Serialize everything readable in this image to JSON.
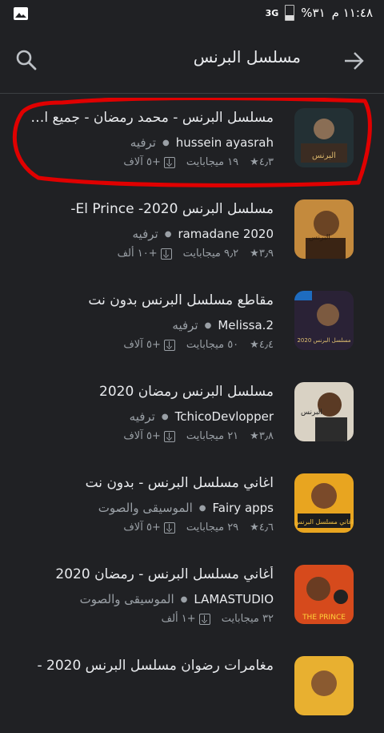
{
  "status_bar": {
    "time": "١١:٤٨ م",
    "battery": "%٣١",
    "signal": "3G"
  },
  "search": {
    "query": "مسلسل البرنس"
  },
  "apps": [
    {
      "title": "مسلسل البرنس - محمد رمضان - جميع ال...",
      "developer": "hussein ayasrah",
      "category": "ترفيه",
      "rating": "٤٫٣",
      "size": "١٩ ميجابايت",
      "installs": "+٥ آلاف"
    },
    {
      "title": "مسلسل البرنس 2020- El Prince-",
      "developer": "ramadane 2020",
      "category": "ترفيه",
      "rating": "٣٫٩",
      "size": "٩٫٢ ميجابايت",
      "installs": "+١٠ ألف"
    },
    {
      "title": "مقاطع مسلسل البرنس بدون نت",
      "developer": "Melissa.2",
      "category": "ترفيه",
      "rating": "٤٫٤",
      "size": "٥٠ ميجابايت",
      "installs": "+٥ آلاف"
    },
    {
      "title": "مسلسل البرنس رمضان 2020",
      "developer": "TchicoDevlopper",
      "category": "ترفيه",
      "rating": "٣٫٨",
      "size": "٢١ ميجابايت",
      "installs": "+٥ آلاف"
    },
    {
      "title": "اغاني مسلسل البرنس - بدون نت",
      "developer": "Fairy apps",
      "category": "الموسيقى والصوت",
      "rating": "٤٫٦",
      "size": "٢٩ ميجابايت",
      "installs": "+٥ آلاف"
    },
    {
      "title": "أغاني مسلسل البرنس - رمضان 2020",
      "developer": "LAMASTUDIO",
      "category": "الموسيقى والصوت",
      "rating": "",
      "size": "٣٢ ميجابايت",
      "installs": "+١ ألف"
    },
    {
      "title": "مغامرات رضوان مسلسل البرنس 2020 -",
      "developer": "",
      "category": "",
      "rating": "",
      "size": "",
      "installs": ""
    }
  ],
  "colors": {
    "background": "#202124",
    "annotation": "#e00000"
  }
}
